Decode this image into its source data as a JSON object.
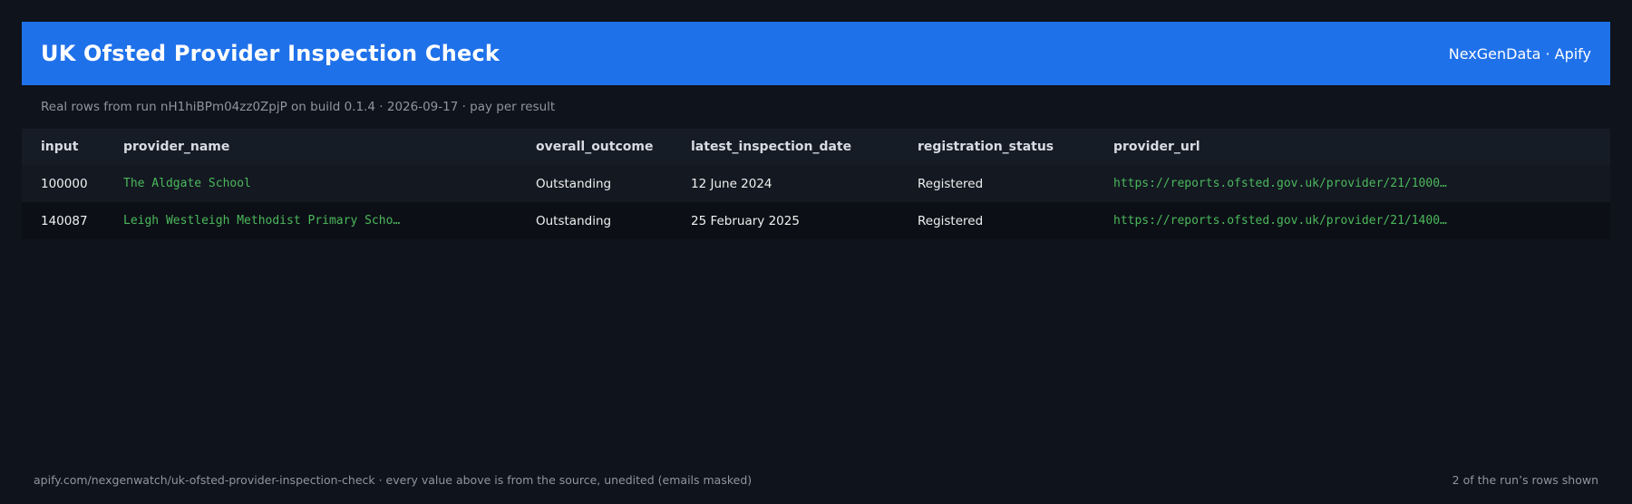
{
  "header": {
    "title": "UK Ofsted Provider Inspection Check",
    "brand": "NexGenData · Apify",
    "accent_color": "#1f71ea"
  },
  "subtitle": "Real rows from run nH1hiBPm04zz0ZpjP on build 0.1.4 · 2026-09-17 · pay per result",
  "table": {
    "columns": [
      "input",
      "provider_name",
      "overall_outcome",
      "latest_inspection_date",
      "registration_status",
      "provider_url"
    ],
    "rows": [
      {
        "input": "100000",
        "provider_name": "The Aldgate School",
        "overall_outcome": "Outstanding",
        "latest_inspection_date": "12 June 2024",
        "registration_status": "Registered",
        "provider_url": "https://reports.ofsted.gov.uk/provider/21/1000…"
      },
      {
        "input": "140087",
        "provider_name": "Leigh Westleigh Methodist Primary Scho…",
        "overall_outcome": "Outstanding",
        "latest_inspection_date": "25 February 2025",
        "registration_status": "Registered",
        "provider_url": "https://reports.ofsted.gov.uk/provider/21/1400…"
      }
    ]
  },
  "footer": {
    "left": "apify.com/nexgenwatch/uk-ofsted-provider-inspection-check  ·  every value above is from the source, unedited (emails masked)",
    "right": "2 of the run’s rows shown"
  },
  "colors": {
    "background": "#0f131b",
    "link_green": "#4cb85c",
    "muted_text": "#8e96a1"
  }
}
